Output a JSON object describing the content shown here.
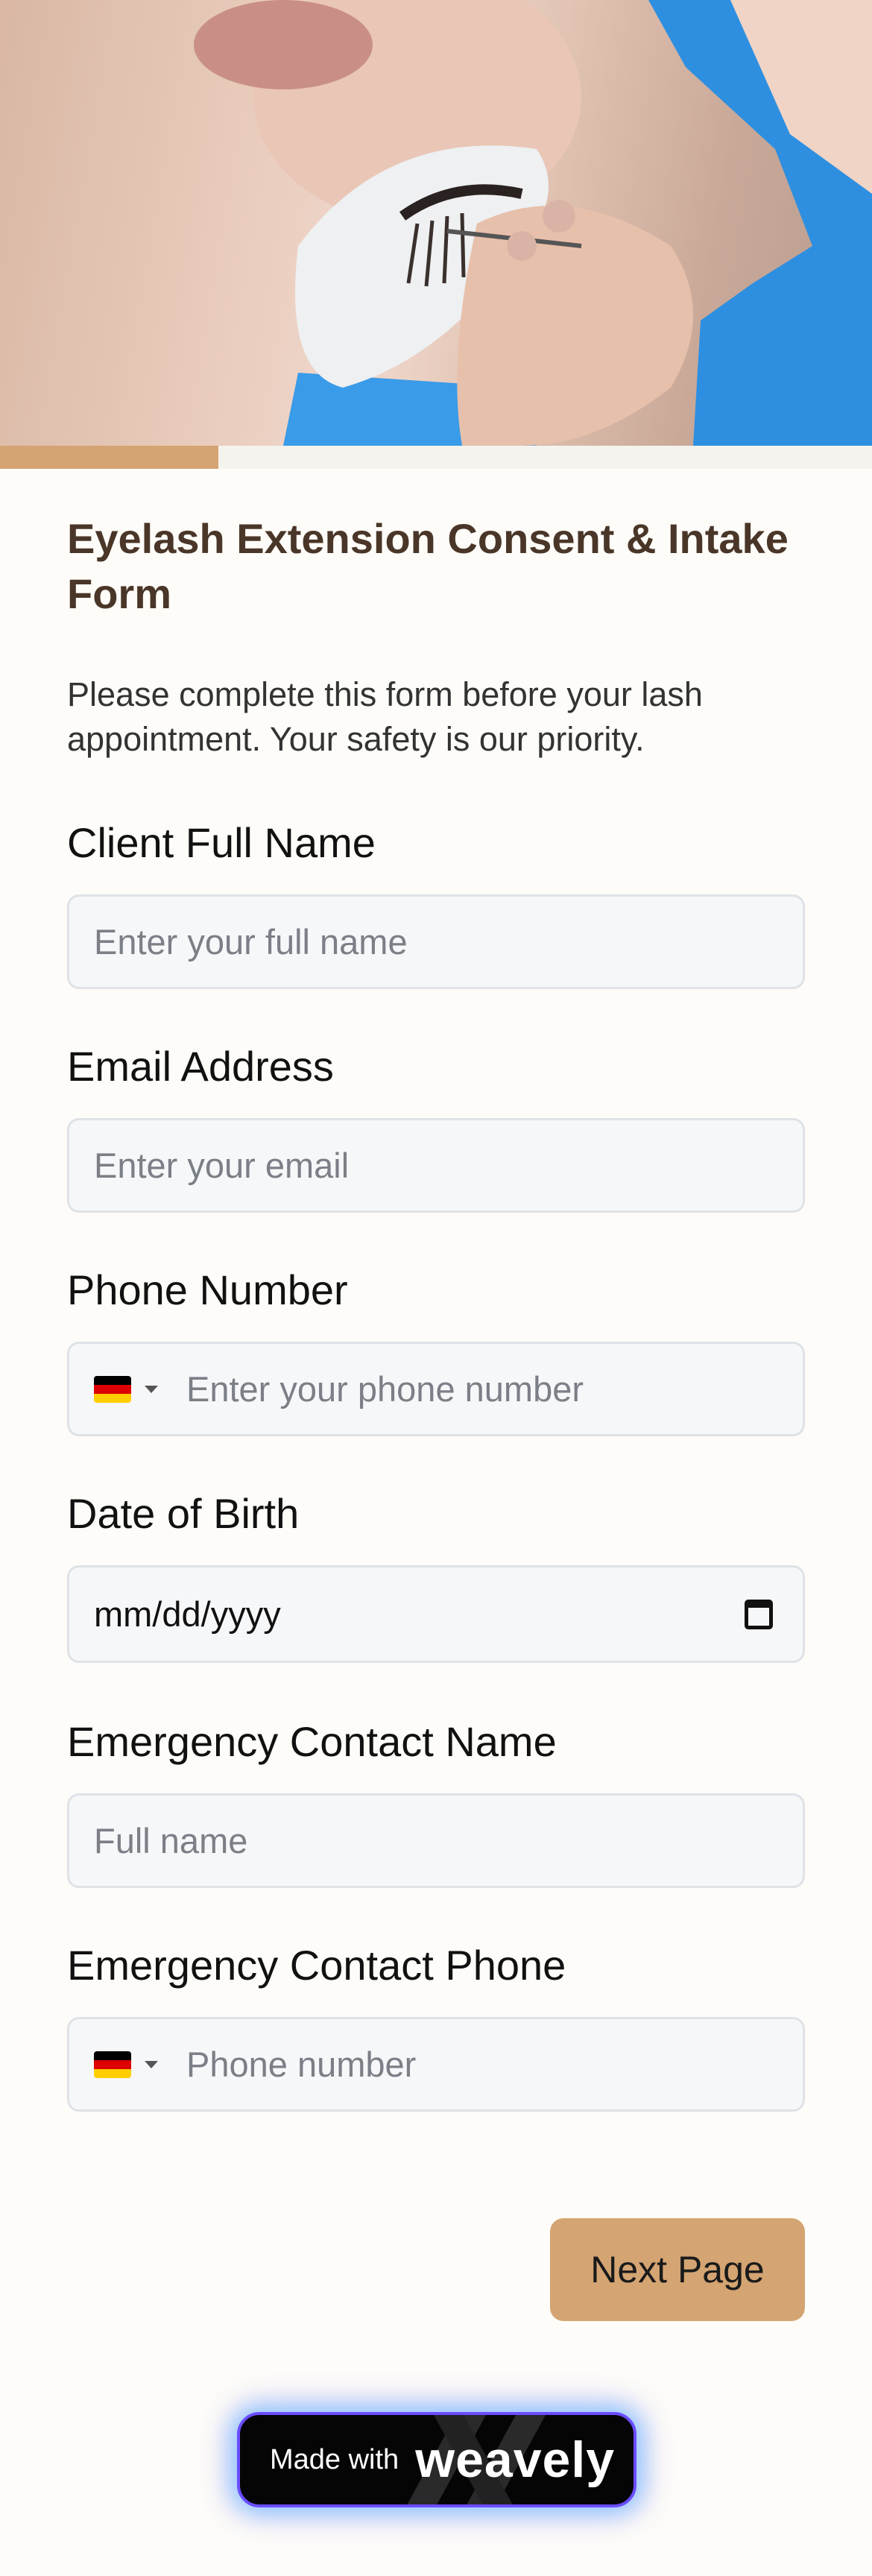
{
  "form": {
    "title": "Eyelash Extension Consent & Intake Form",
    "description": "Please complete this form before your lash appointment. Your safety is our priority.",
    "progress": 0.25,
    "fields": {
      "client_name": {
        "label": "Client Full Name",
        "placeholder": "Enter your full name"
      },
      "email": {
        "label": "Email Address",
        "placeholder": "Enter your email"
      },
      "phone": {
        "label": "Phone Number",
        "placeholder": "Enter your phone number",
        "country_flag": "germany-flag-icon"
      },
      "dob": {
        "label": "Date of Birth",
        "value": "mm/dd/yyyy"
      },
      "emergency_name": {
        "label": "Emergency Contact Name",
        "placeholder": "Full name"
      },
      "emergency_phone": {
        "label": "Emergency Contact Phone",
        "placeholder": "Phone number",
        "country_flag": "germany-flag-icon"
      }
    },
    "next_button": "Next Page"
  },
  "badge": {
    "made_with": "Made with",
    "brand": "weavely"
  },
  "colors": {
    "accent": "#d4a472",
    "title": "#4a3628",
    "background": "#fdfcf8",
    "field_bg": "#f6f7f9"
  }
}
